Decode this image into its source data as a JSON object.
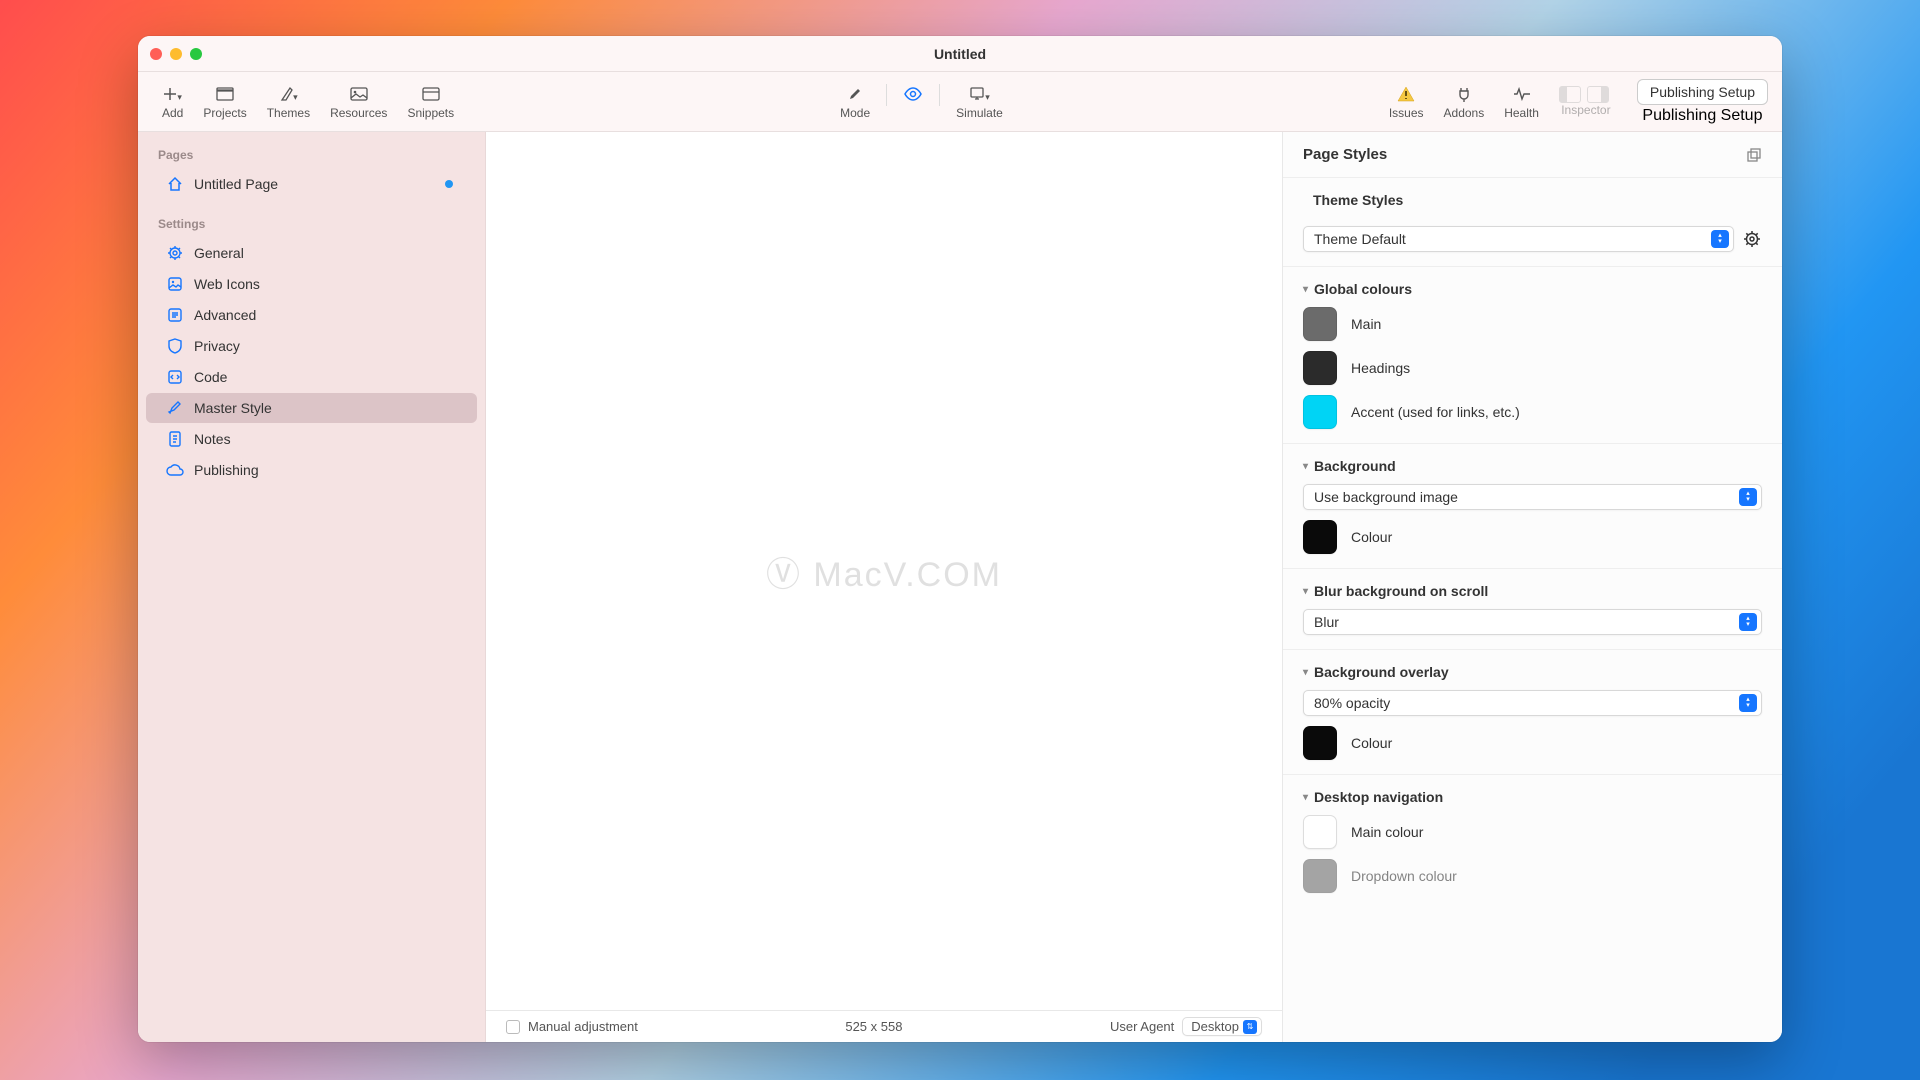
{
  "window": {
    "title": "Untitled"
  },
  "toolbar": {
    "left": [
      {
        "label": "Add",
        "icon": "plus"
      },
      {
        "label": "Projects",
        "icon": "folder"
      },
      {
        "label": "Themes",
        "icon": "palette"
      },
      {
        "label": "Resources",
        "icon": "image"
      },
      {
        "label": "Snippets",
        "icon": "snippet"
      }
    ],
    "center": [
      {
        "label": "Mode",
        "icon": "pencil"
      },
      {
        "label": "Simulate",
        "icon": "simulate"
      }
    ],
    "centerEye": "eye",
    "right": [
      {
        "label": "Issues",
        "icon": "warning"
      },
      {
        "label": "Addons",
        "icon": "plug"
      },
      {
        "label": "Health",
        "icon": "pulse"
      },
      {
        "label": "Inspector",
        "icon": "inspector",
        "dim": true
      }
    ],
    "publishSetup": "Publishing Setup",
    "publishSetupLabel": "Publishing Setup"
  },
  "sidebar": {
    "pagesHeading": "Pages",
    "settingsHeading": "Settings",
    "pages": [
      {
        "label": "Untitled Page",
        "icon": "home",
        "dot": true
      }
    ],
    "settings": [
      {
        "label": "General",
        "icon": "gear"
      },
      {
        "label": "Web Icons",
        "icon": "webicon"
      },
      {
        "label": "Advanced",
        "icon": "advanced"
      },
      {
        "label": "Privacy",
        "icon": "shield"
      },
      {
        "label": "Code",
        "icon": "code"
      },
      {
        "label": "Master Style",
        "icon": "brush",
        "selected": true
      },
      {
        "label": "Notes",
        "icon": "notes"
      },
      {
        "label": "Publishing",
        "icon": "cloud"
      }
    ]
  },
  "canvas": {
    "watermark": "Ⓥ MacV.COM",
    "manualAdjustment": "Manual adjustment",
    "dimensions": "525 x 558",
    "userAgent": "User Agent",
    "desktop": "Desktop"
  },
  "inspector": {
    "header": "Page Styles",
    "themeStylesHeading": "Theme Styles",
    "themeSelect": "Theme Default",
    "sections": {
      "globalColours": {
        "title": "Global colours",
        "items": [
          {
            "label": "Main",
            "color": "#6b6b6b"
          },
          {
            "label": "Headings",
            "color": "#2b2b2b"
          },
          {
            "label": "Accent (used for links, etc.)",
            "color": "#00d4f5"
          }
        ]
      },
      "background": {
        "title": "Background",
        "select": "Use background image",
        "colourLabel": "Colour",
        "colour": "#0a0a0a"
      },
      "blur": {
        "title": "Blur background on scroll",
        "select": "Blur"
      },
      "overlay": {
        "title": "Background overlay",
        "select": "80% opacity",
        "colourLabel": "Colour",
        "colour": "#0a0a0a"
      },
      "desktopNav": {
        "title": "Desktop navigation",
        "items": [
          {
            "label": "Main colour",
            "color": "#ffffff"
          },
          {
            "label": "Dropdown colour",
            "color": "#6b6b6b"
          }
        ]
      }
    }
  }
}
